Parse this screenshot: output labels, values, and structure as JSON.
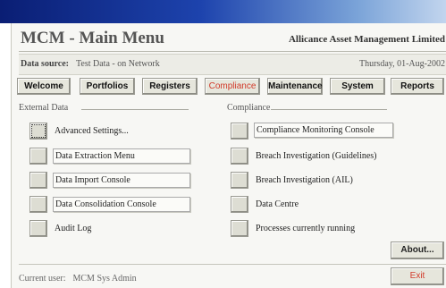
{
  "app_title": "MCM - Main Menu",
  "company": "Allicance Asset Management Limited",
  "data_source": {
    "label": "Data source:",
    "value": "Test Data - on Network",
    "date": "Thursday, 01-Aug-2002"
  },
  "tabs": [
    {
      "label": "Welcome"
    },
    {
      "label": "Portfolios"
    },
    {
      "label": "Registers"
    },
    {
      "label": "Compliance",
      "active": true
    },
    {
      "label": "Maintenance"
    },
    {
      "label": "System"
    },
    {
      "label": "Reports"
    }
  ],
  "external_data": {
    "title": "External Data",
    "items": [
      {
        "label": "Advanced Settings..."
      },
      {
        "label": "Data Extraction Menu"
      },
      {
        "label": "Data Import Console"
      },
      {
        "label": "Data Consolidation Console"
      },
      {
        "label": "Audit Log"
      }
    ]
  },
  "compliance": {
    "title": "Compliance",
    "items": [
      {
        "label": "Compliance Monitoring Console"
      },
      {
        "label": "Breach Investigation (Guidelines)"
      },
      {
        "label": "Breach Investigation (AIL)"
      },
      {
        "label": "Data Centre"
      },
      {
        "label": "Processes currently running"
      }
    ]
  },
  "about_label": "About...",
  "current_user": {
    "label": "Current user:",
    "name": "MCM Sys Admin"
  },
  "exit_label": "Exit",
  "colors": {
    "accent_red": "#d13a2a",
    "titlebar_blue": "#1d43ad"
  }
}
